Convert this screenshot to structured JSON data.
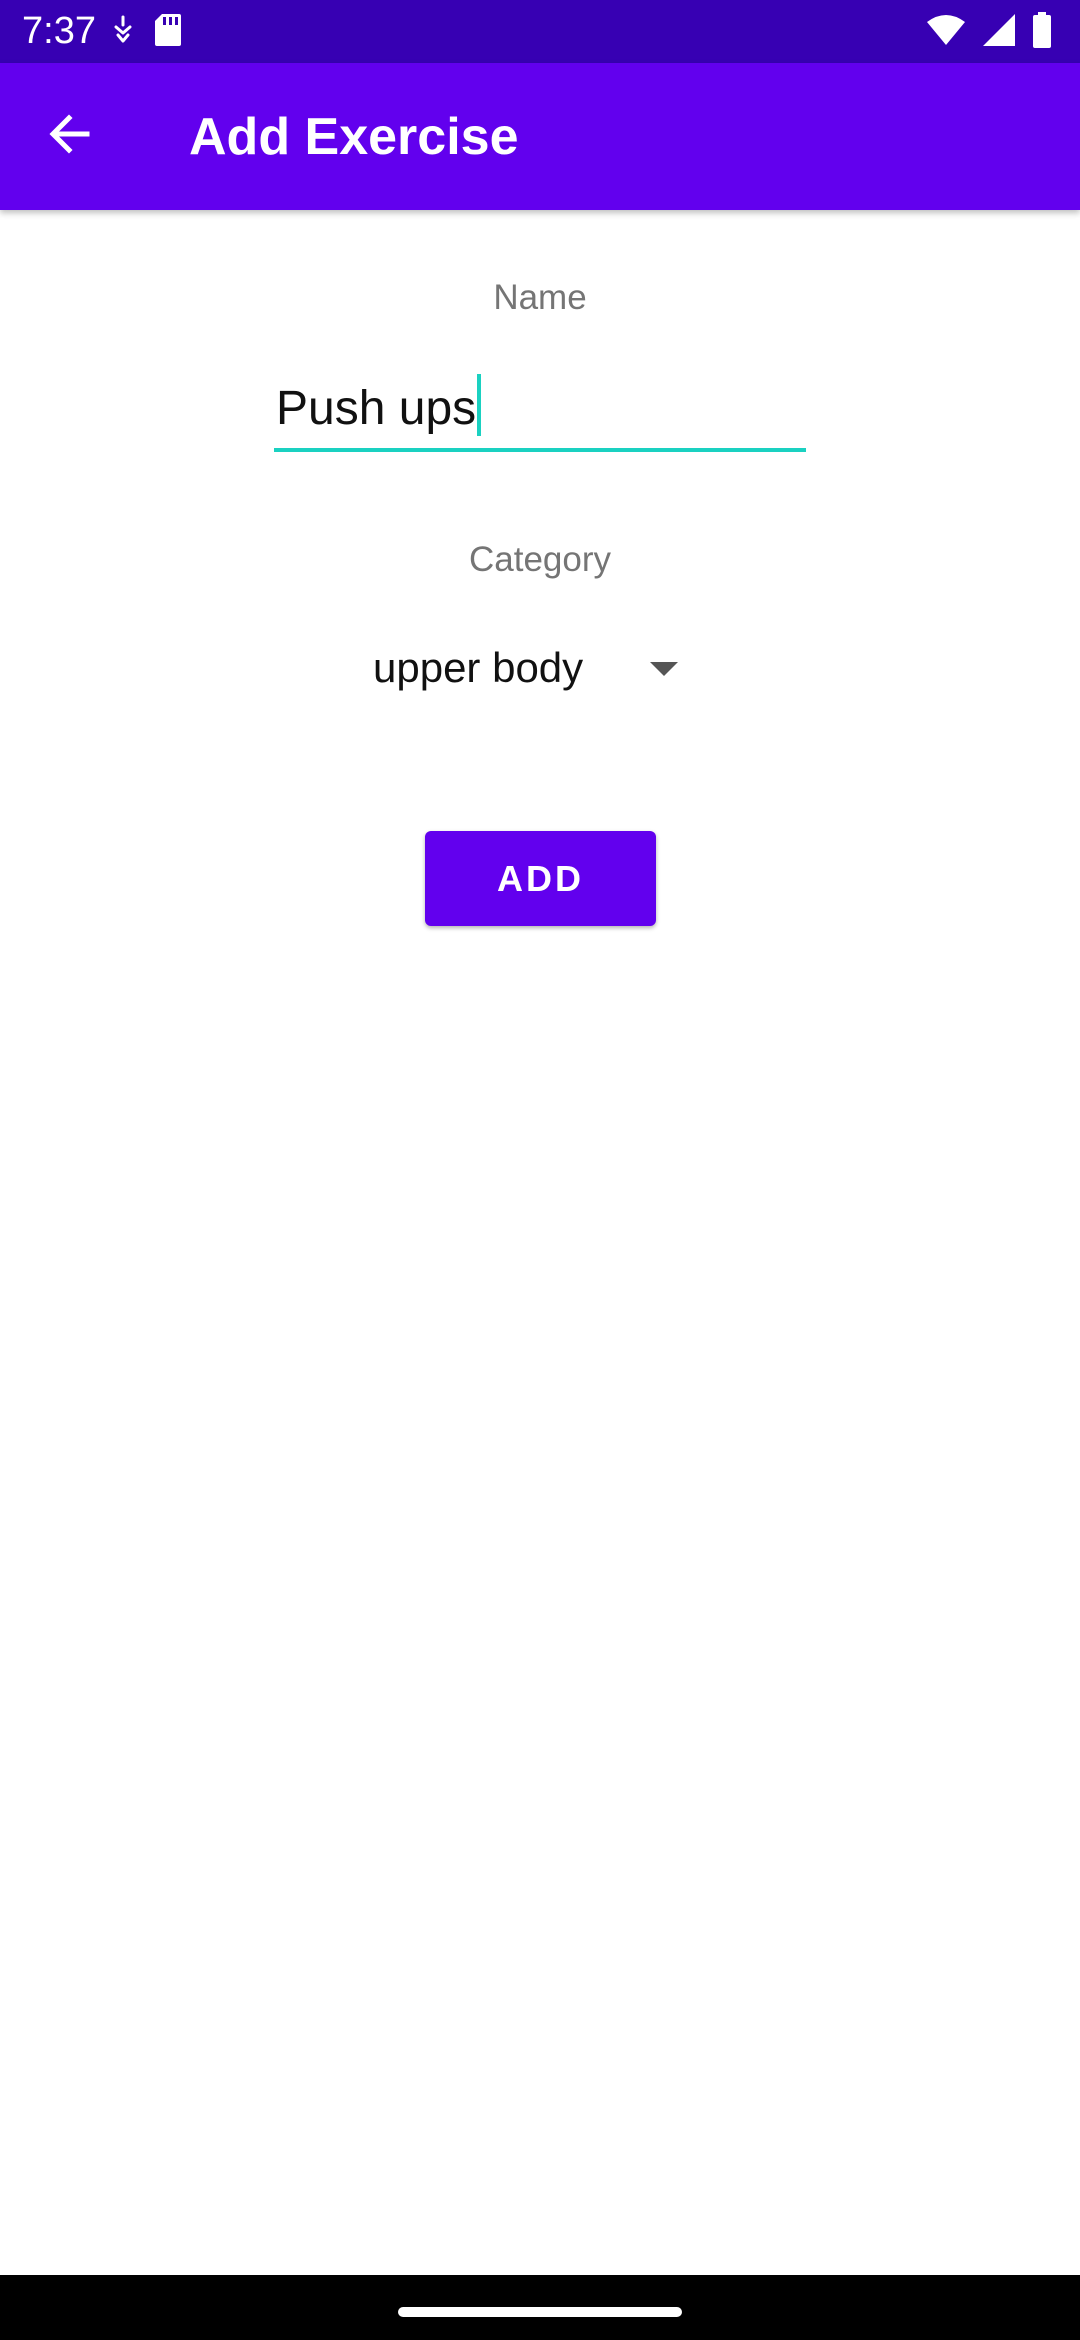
{
  "status_bar": {
    "time": "7:37",
    "icons": [
      "notification-icon",
      "sd-card-icon",
      "wifi-icon",
      "signal-icon",
      "battery-icon"
    ],
    "background": "#3700b3"
  },
  "app_bar": {
    "title": "Add Exercise",
    "back_icon": "arrow-back-icon",
    "background": "#6200ee"
  },
  "form": {
    "name_label": "Name",
    "name_value": "Push ups",
    "category_label": "Category",
    "category_value": "upper body",
    "add_label": "ADD"
  },
  "colors": {
    "accent": "#1ad1c1",
    "primary": "#6200ee"
  }
}
